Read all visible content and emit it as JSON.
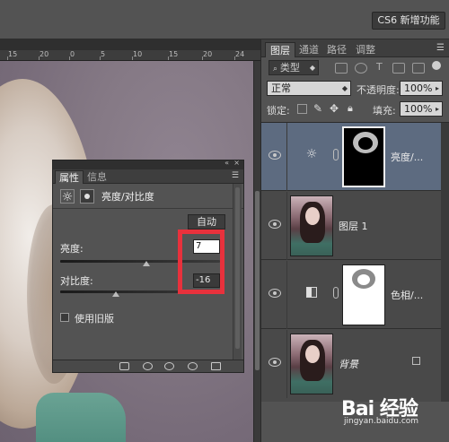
{
  "topbar": {
    "workspace_label": "CS6 新增功能"
  },
  "ruler": {
    "labels": [
      "15",
      "20",
      "0",
      "5",
      "10",
      "15",
      "20",
      "24"
    ]
  },
  "layers_panel": {
    "tabs": [
      "图层",
      "通道",
      "路径",
      "调整"
    ],
    "active_tab": 0,
    "filter_kind": "类型",
    "blend_mode": "正常",
    "opacity_label": "不透明度:",
    "opacity_value": "100%",
    "lock_label": "锁定:",
    "fill_label": "填充:",
    "fill_value": "100%",
    "layers": [
      {
        "name": "亮度/...",
        "type": "adjustment",
        "adjust_icon": "brightness-icon",
        "selected": true
      },
      {
        "name": "图层 1",
        "type": "pixel",
        "selected": false
      },
      {
        "name": "色相/...",
        "type": "adjustment",
        "adjust_icon": "hue-saturation-icon",
        "selected": false
      },
      {
        "name": "背景",
        "type": "background",
        "locked": true,
        "selected": false
      }
    ]
  },
  "properties_panel": {
    "tabs": [
      "属性",
      "信息"
    ],
    "active_tab": 0,
    "title": "亮度/对比度",
    "auto_label": "自动",
    "brightness_label": "亮度:",
    "brightness_value": "7",
    "contrast_label": "对比度:",
    "contrast_value": "-16",
    "legacy_label": "使用旧版",
    "legacy_checked": false
  },
  "watermark": {
    "logo": "Bai 经验",
    "url": "jingyan.baidu.com"
  },
  "colors": {
    "panel_bg": "#535353",
    "selected_layer": "#5d6b80",
    "highlight": "#e8313c"
  }
}
